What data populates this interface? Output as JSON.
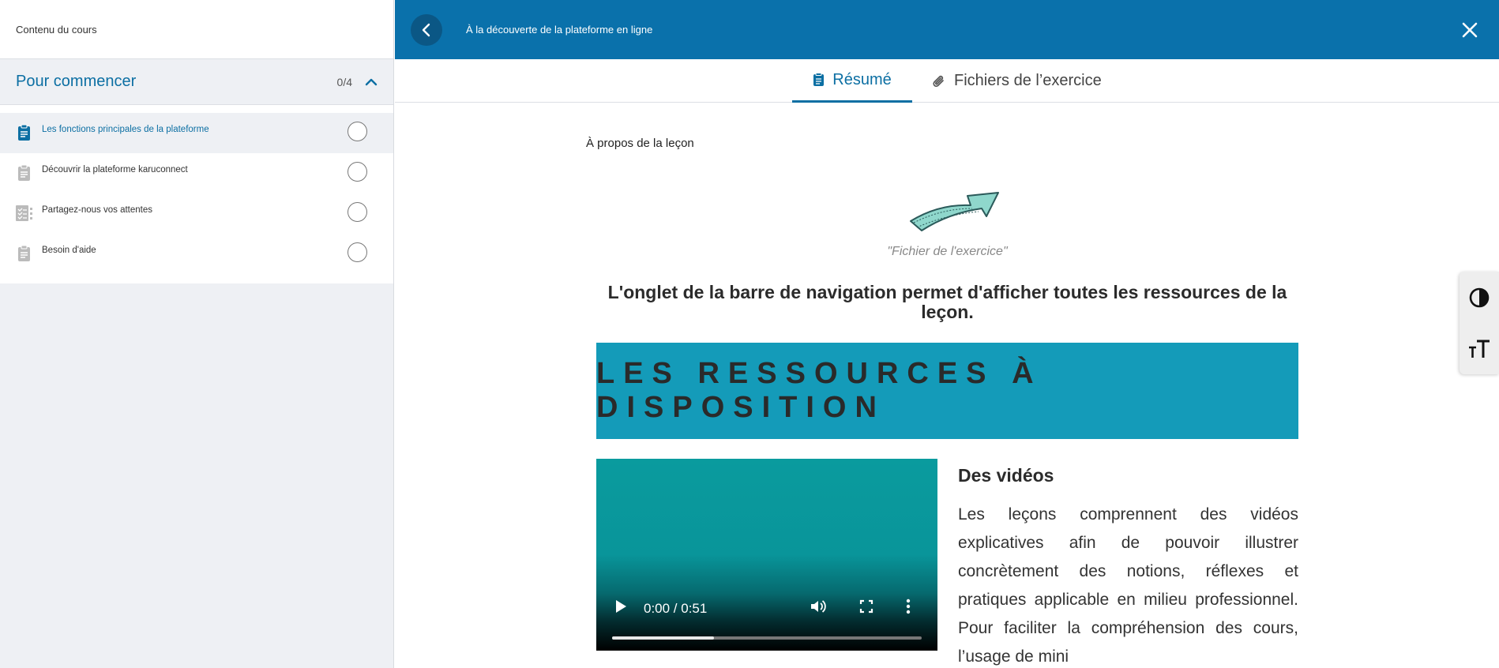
{
  "sidebar": {
    "heading": "Contenu du cours",
    "section": {
      "title": "Pour commencer",
      "count": "0/4"
    },
    "lessons": [
      {
        "label": "Les fonctions principales de la plateforme",
        "icon": "document-icon",
        "active": true
      },
      {
        "label": "Découvrir la plateforme karuconnect",
        "icon": "document-icon",
        "active": false
      },
      {
        "label": "Partagez-nous vos attentes",
        "icon": "checklist-icon",
        "active": false
      },
      {
        "label": "Besoin d'aide",
        "icon": "document-icon",
        "active": false
      }
    ]
  },
  "topbar": {
    "title": "À la découverte de la plateforme en ligne"
  },
  "tabs": [
    {
      "label": "Résumé",
      "icon": "document-icon",
      "active": true
    },
    {
      "label": "Fichiers de l’exercice",
      "icon": "paperclip-icon",
      "active": false
    }
  ],
  "content": {
    "about": "À propos de la leçon",
    "caption": "\"Fichier de l'exercice\"",
    "bold_text": "L'onglet de la barre de navigation permet d'afficher toutes les ressources de la leçon.",
    "banner": "LES RESSOURCES À DISPOSITION",
    "video": {
      "time": "0:00 / 0:51",
      "progress": 0.33
    },
    "section_title": "Des vidéos",
    "section_body": "Les leçons comprennent des vidéos explicatives afin de pouvoir illustrer concrètement des notions, réflexes et pratiques applicable en milieu professionnel. Pour faciliter la compréhension des cours, l’usage de mini"
  },
  "colors": {
    "primary": "#0a71ab",
    "banner": "#149bb9",
    "video": "#0a9b9e"
  }
}
